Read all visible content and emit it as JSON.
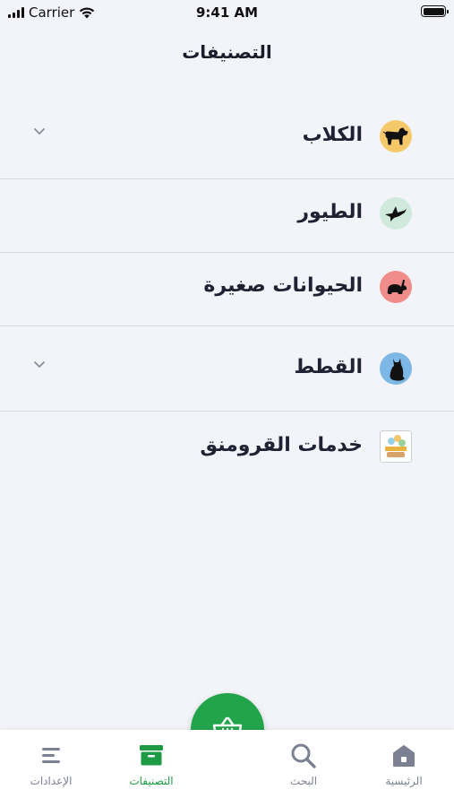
{
  "status_bar": {
    "carrier": "Carrier",
    "time": "9:41 AM"
  },
  "header": {
    "title": "التصنيفات"
  },
  "categories": [
    {
      "label": "الكلاب",
      "icon": "dog-icon",
      "icon_bg": "#f5c86a",
      "expandable": true
    },
    {
      "label": "الطيور",
      "icon": "bird-icon",
      "icon_bg": "#cfe9dd",
      "expandable": false
    },
    {
      "label": "الحيوانات صغيرة",
      "icon": "rabbit-icon",
      "icon_bg": "#f08d8a",
      "expandable": false
    },
    {
      "label": "القطط",
      "icon": "cat-icon",
      "icon_bg": "#7db7e6",
      "expandable": true
    },
    {
      "label": "خدمات القرومنق",
      "icon": "grooming-logo-icon",
      "icon_bg": "#ffffff",
      "expandable": false
    }
  ],
  "bottom_nav": {
    "items": [
      {
        "label": "الرئيسية",
        "icon": "home-icon",
        "active": false
      },
      {
        "label": "البحث",
        "icon": "search-icon",
        "active": false
      },
      {
        "label": "التصنيفات",
        "icon": "categories-icon",
        "active": true
      },
      {
        "label": "الإعدادات",
        "icon": "settings-menu-icon",
        "active": false
      }
    ],
    "fab_icon": "basket-icon"
  },
  "colors": {
    "accent": "#22a44b",
    "active_label": "#1e9a45",
    "background": "#f2f4f9",
    "inactive": "#7b8193"
  }
}
